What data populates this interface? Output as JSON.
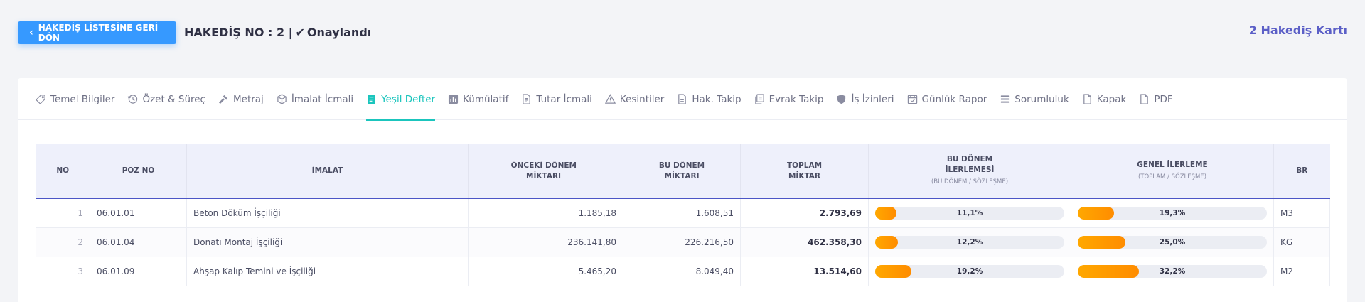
{
  "header": {
    "back_label": "HAKEDİŞ LİSTESİNE GERİ DÖN",
    "title_prefix": "HAKEDİŞ NO : 2 |",
    "status": "Onaylandı",
    "card_count": "2 Hakediş Kartı"
  },
  "tabs": [
    {
      "label": "Temel Bilgiler",
      "icon": "tag-icon"
    },
    {
      "label": "Özet & Süreç",
      "icon": "history-icon"
    },
    {
      "label": "Metraj",
      "icon": "hammer-icon"
    },
    {
      "label": "İmalat İcmali",
      "icon": "cube-icon"
    },
    {
      "label": "Yeşil Defter",
      "icon": "book-icon",
      "active": true
    },
    {
      "label": "Kümülatif",
      "icon": "bar-chart-icon"
    },
    {
      "label": "Tutar İcmali",
      "icon": "document-icon"
    },
    {
      "label": "Kesintiler",
      "icon": "warning-icon"
    },
    {
      "label": "Hak. Takip",
      "icon": "file-icon"
    },
    {
      "label": "Evrak Takip",
      "icon": "documents-icon"
    },
    {
      "label": "İş İzinleri",
      "icon": "shield-icon"
    },
    {
      "label": "Günlük Rapor",
      "icon": "calendar-check-icon"
    },
    {
      "label": "Sorumluluk",
      "icon": "list-icon"
    },
    {
      "label": "Kapak",
      "icon": "page-icon"
    },
    {
      "label": "PDF",
      "icon": "pdf-icon"
    }
  ],
  "table": {
    "headers": {
      "no": "NO",
      "poz": "POZ NO",
      "imalat": "İMALAT",
      "onceki_1": "ÖNCEKİ DÖNEM",
      "onceki_2": "MİKTARI",
      "bu_1": "BU DÖNEM",
      "bu_2": "MİKTARI",
      "toplam_1": "TOPLAM",
      "toplam_2": "MİKTAR",
      "bu_ilerleme_1": "BU DÖNEM",
      "bu_ilerleme_2": "İLERLEMESİ",
      "bu_ilerleme_sub": "(BU DÖNEM / SÖZLEŞME)",
      "genel_1": "GENEL İLERLEME",
      "genel_sub": "(TOPLAM / SÖZLEŞME)",
      "br": "BR"
    },
    "rows": [
      {
        "no": "1",
        "poz": "06.01.01",
        "imalat": "Beton Döküm İşçiliği",
        "onceki": "1.185,18",
        "bu": "1.608,51",
        "toplam": "2.793,69",
        "bu_pct": "11,1%",
        "bu_frac": 0.111,
        "genel_pct": "19,3%",
        "genel_frac": 0.193,
        "br": "M3"
      },
      {
        "no": "2",
        "poz": "06.01.04",
        "imalat": "Donatı Montaj İşçiliği",
        "onceki": "236.141,80",
        "bu": "226.216,50",
        "toplam": "462.358,30",
        "bu_pct": "12,2%",
        "bu_frac": 0.122,
        "genel_pct": "25,0%",
        "genel_frac": 0.25,
        "br": "KG"
      },
      {
        "no": "3",
        "poz": "06.01.09",
        "imalat": "Ahşap Kalıp Temini ve İşçiliği",
        "onceki": "5.465,20",
        "bu": "8.049,40",
        "toplam": "13.514,60",
        "bu_pct": "19,2%",
        "bu_frac": 0.192,
        "genel_pct": "32,2%",
        "genel_frac": 0.322,
        "br": "M2"
      }
    ]
  },
  "colors": {
    "primary": "#3699ff",
    "active_tab": "#1bc5bd",
    "accent": "#5b5fc7",
    "bar_fill": "#ffa800"
  }
}
